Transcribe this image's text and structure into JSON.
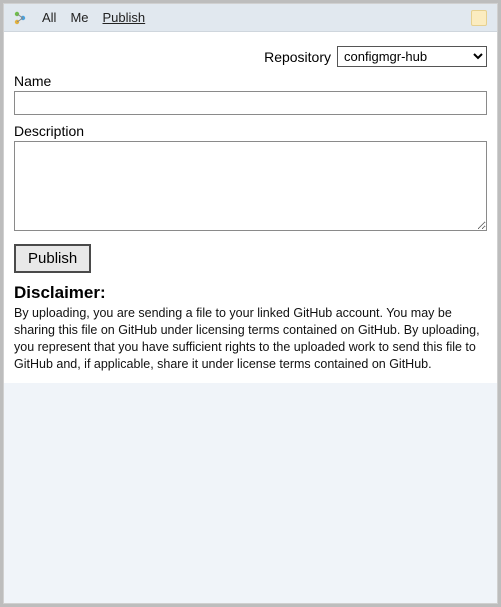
{
  "tabs": {
    "all": "All",
    "me": "Me",
    "publish": "Publish"
  },
  "form": {
    "repo_label": "Repository",
    "repo_options": [
      "configmgr-hub"
    ],
    "repo_selected": "configmgr-hub",
    "name_label": "Name",
    "name_value": "",
    "desc_label": "Description",
    "desc_value": "",
    "publish_button": "Publish"
  },
  "disclaimer": {
    "title": "Disclaimer:",
    "text": "By uploading, you are sending a file to your linked GitHub account. You may be sharing this file on GitHub under licensing terms contained on GitHub. By uploading, you represent that you have sufficient rights to the uploaded work to send this file to GitHub and, if applicable, share it under license terms contained on GitHub."
  }
}
